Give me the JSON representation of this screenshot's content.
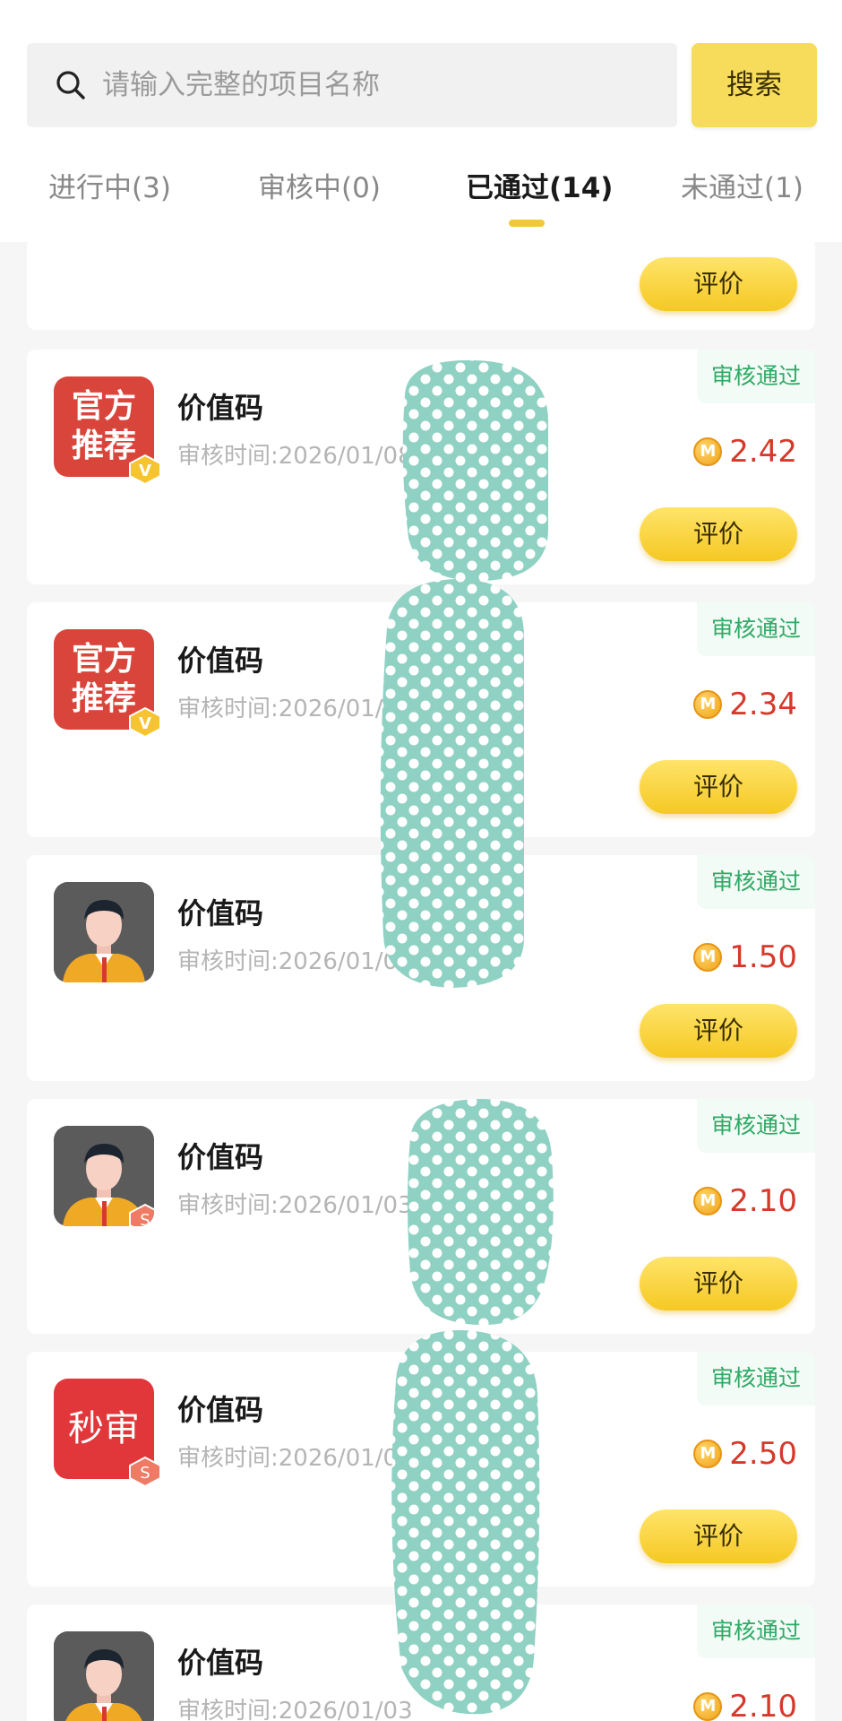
{
  "search": {
    "placeholder": "请输入完整的项目名称",
    "button_label": "搜索"
  },
  "tabs": [
    {
      "label": "进行中(3)",
      "active": false
    },
    {
      "label": "审核中(0)",
      "active": false
    },
    {
      "label": "已通过(14)",
      "active": true
    },
    {
      "label": "未通过(1)",
      "active": false
    }
  ],
  "first_card": {
    "rate_label": "评价"
  },
  "cards": [
    {
      "icon": "official-recommend-icon",
      "icon_line1": "官方",
      "icon_line2": "推荐",
      "badge": "V",
      "title": "价值码",
      "time": "审核时间:2026/01/08",
      "status": "审核通过",
      "coin": "M",
      "amount": "2.42",
      "rate_label": "评价"
    },
    {
      "icon": "official-recommend-icon",
      "icon_line1": "官方",
      "icon_line2": "推荐",
      "badge": "V",
      "title": "价值码",
      "time": "审核时间:2026/01/",
      "status": "审核通过",
      "coin": "M",
      "amount": "2.34",
      "rate_label": "评价"
    },
    {
      "icon": "person-avatar-icon",
      "title": "价值码",
      "time": "审核时间:2026/01/0",
      "status": "审核通过",
      "coin": "M",
      "amount": "1.50",
      "rate_label": "评价"
    },
    {
      "icon": "person-avatar-icon",
      "badge": "S",
      "title": "价值码",
      "time": "审核时间:2026/01/03",
      "status": "审核通过",
      "coin": "M",
      "amount": "2.10",
      "rate_label": "评价"
    },
    {
      "icon": "instant-review-icon",
      "icon_line1": "秒审",
      "badge": "S",
      "title": "价值码",
      "time": "审核时间:2026/01/0",
      "status": "审核通过",
      "coin": "M",
      "amount": "2.50",
      "rate_label": "评价"
    },
    {
      "icon": "person-avatar-icon",
      "title": "价值码",
      "time": "审核时间:2026/01/03",
      "status": "审核通过",
      "coin": "M",
      "amount": "2.10",
      "rate_label": "评价"
    }
  ],
  "colors": {
    "accent_yellow": "#f6dc5a",
    "status_green": "#2eaa66",
    "amount_red": "#d6392b",
    "mask_teal": "#8fd1c3"
  }
}
